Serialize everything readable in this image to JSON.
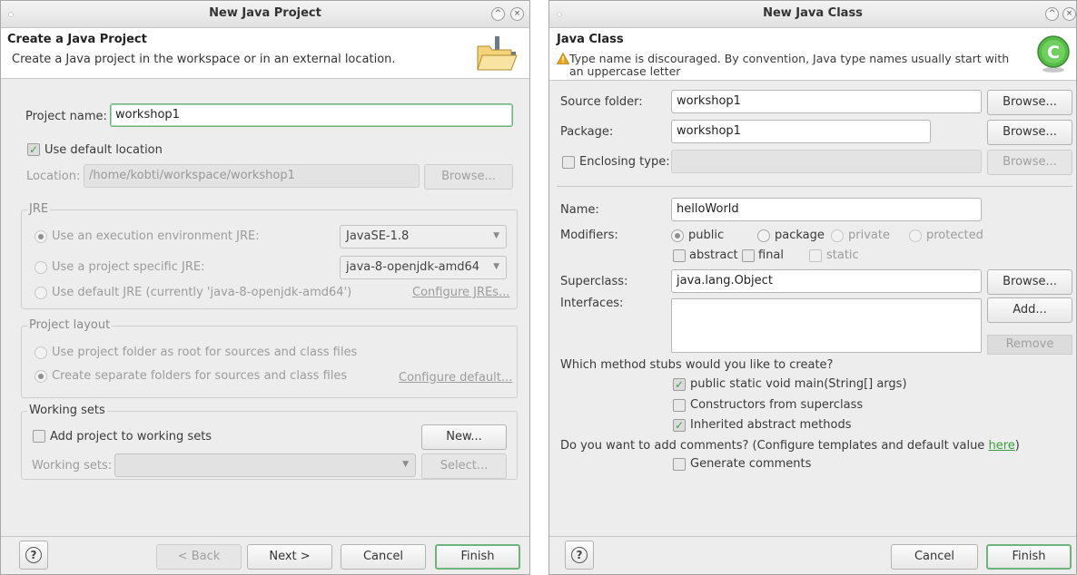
{
  "project_dialog": {
    "title": "New Java Project",
    "header_title": "Create a Java Project",
    "header_desc": "Create a Java project in the workspace or in an external location.",
    "project_name_label": "Project name:",
    "project_name_value": "workshop1",
    "use_default_location": "Use default location",
    "location_label": "Location:",
    "location_value": "/home/kobti/workspace/workshop1",
    "browse": "Browse...",
    "jre_group": "JRE",
    "jre_exec_env": "Use an execution environment JRE:",
    "jre_exec_env_value": "JavaSE-1.8",
    "jre_project_specific": "Use a project specific JRE:",
    "jre_project_specific_value": "java-8-openjdk-amd64",
    "jre_default": "Use default JRE (currently 'java-8-openjdk-amd64')",
    "configure_jres": "Configure JREs...",
    "layout_group": "Project layout",
    "layout_root": "Use project folder as root for sources and class files",
    "layout_separate": "Create separate folders for sources and class files",
    "configure_default": "Configure default...",
    "working_sets_group": "Working sets",
    "add_to_working_sets": "Add project to working sets",
    "new_button": "New...",
    "working_sets_label": "Working sets:",
    "select_button": "Select...",
    "help": "?",
    "back": "< Back",
    "next": "Next >",
    "cancel": "Cancel",
    "finish": "Finish"
  },
  "class_dialog": {
    "title": "New Java Class",
    "header_title": "Java Class",
    "warning_line1": "Type name is discouraged. By convention, Java type names usually start with",
    "warning_line2": "an uppercase letter",
    "source_folder_label": "Source folder:",
    "source_folder_value": "workshop1",
    "package_label": "Package:",
    "package_value": "workshop1",
    "enclosing_type_label": "Enclosing type:",
    "browse": "Browse...",
    "name_label": "Name:",
    "name_value": "helloWorld",
    "modifiers_label": "Modifiers:",
    "mod_public": "public",
    "mod_package": "package",
    "mod_private": "private",
    "mod_protected": "protected",
    "mod_abstract": "abstract",
    "mod_final": "final",
    "mod_static": "static",
    "superclass_label": "Superclass:",
    "superclass_value": "java.lang.Object",
    "interfaces_label": "Interfaces:",
    "add_button": "Add...",
    "remove_button": "Remove",
    "stubs_question": "Which method stubs would you like to create?",
    "stub_main": "public static void main(String[] args)",
    "stub_constructors": "Constructors from superclass",
    "stub_inherited": "Inherited abstract methods",
    "comments_question": "Do you want to add comments? (Configure templates and default value ",
    "comments_here": "here",
    "comments_close": ")",
    "generate_comments": "Generate comments",
    "help": "?",
    "cancel": "Cancel",
    "finish": "Finish"
  },
  "colors": {
    "accent": "#6fb37c",
    "link": "#3c9b3c",
    "warning": "#e8a317"
  },
  "icons": {
    "header_left": "folder-open-icon",
    "header_right": "java-class-icon",
    "warning": "warning-icon",
    "help": "help-icon"
  }
}
